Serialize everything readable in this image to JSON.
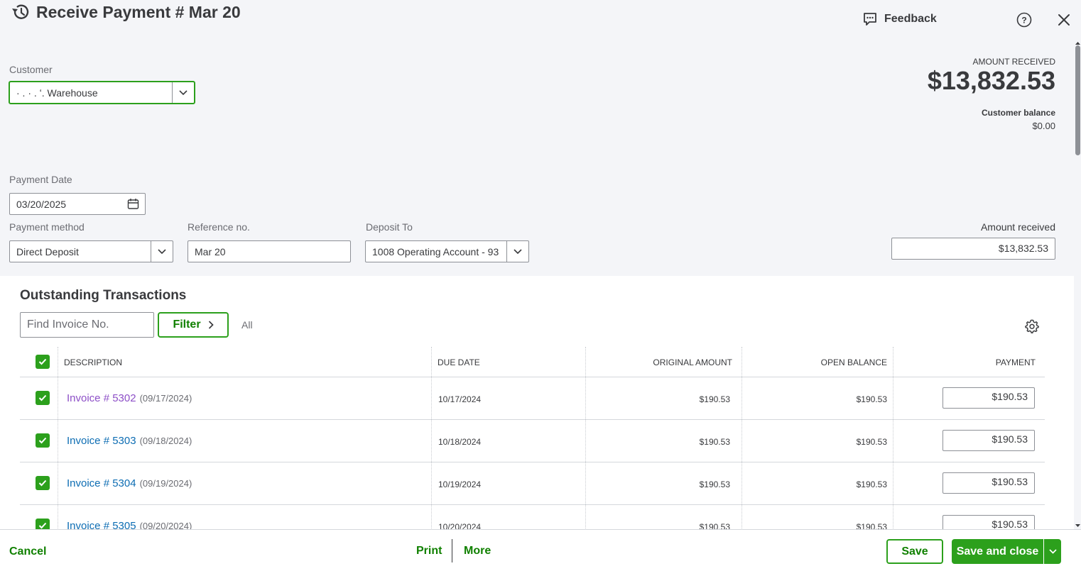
{
  "header": {
    "title": "Receive Payment # Mar 20",
    "feedback_label": "Feedback"
  },
  "customer": {
    "label": "Customer",
    "value": "· . · . ʻ. Warehouse"
  },
  "summary": {
    "amount_received_label": "AMOUNT RECEIVED",
    "amount_received_value": "$13,832.53",
    "customer_balance_label": "Customer balance",
    "customer_balance_value": "$0.00"
  },
  "payment": {
    "date_label": "Payment Date",
    "date_value": "03/20/2025",
    "method_label": "Payment method",
    "method_value": "Direct Deposit",
    "reference_label": "Reference no.",
    "reference_value": "Mar 20",
    "deposit_label": "Deposit To",
    "deposit_value": "1008 Operating Account - 93",
    "amount_label": "Amount received",
    "amount_value": "$13,832.53"
  },
  "outstanding": {
    "title": "Outstanding Transactions",
    "find_placeholder": "Find Invoice No.",
    "filter_label": "Filter",
    "all_label": "All",
    "columns": {
      "description": "DESCRIPTION",
      "due_date": "DUE DATE",
      "original_amount": "ORIGINAL AMOUNT",
      "open_balance": "OPEN BALANCE",
      "payment": "PAYMENT"
    },
    "rows": [
      {
        "invoice": "Invoice # 5302",
        "date": "(09/17/2024)",
        "due": "10/17/2024",
        "original": "$190.53",
        "open": "$190.53",
        "payment": "$190.53",
        "checked": true
      },
      {
        "invoice": "Invoice # 5303",
        "date": "(09/18/2024)",
        "due": "10/18/2024",
        "original": "$190.53",
        "open": "$190.53",
        "payment": "$190.53",
        "checked": true
      },
      {
        "invoice": "Invoice # 5304",
        "date": "(09/19/2024)",
        "due": "10/19/2024",
        "original": "$190.53",
        "open": "$190.53",
        "payment": "$190.53",
        "checked": true
      },
      {
        "invoice": "Invoice # 5305",
        "date": "(09/20/2024)",
        "due": "10/20/2024",
        "original": "$190.53",
        "open": "$190.53",
        "payment": "$190.53",
        "checked": true
      }
    ]
  },
  "footer": {
    "cancel_label": "Cancel",
    "print_label": "Print",
    "more_label": "More",
    "save_label": "Save",
    "save_close_label": "Save and close"
  },
  "colors": {
    "accent_green": "#2ca01c",
    "link_blue": "#0d6db3",
    "link_visited": "#8d4fc7"
  }
}
